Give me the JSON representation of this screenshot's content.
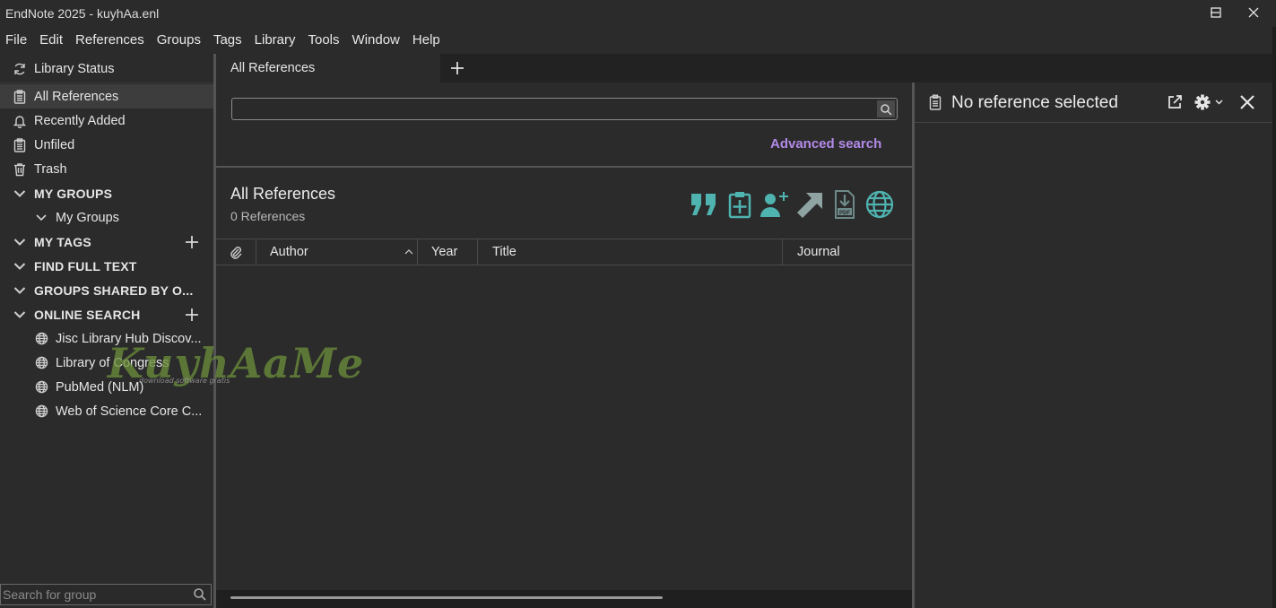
{
  "window": {
    "title": "EndNote 2025 - kuyhAa.enl"
  },
  "menu": [
    "File",
    "Edit",
    "References",
    "Groups",
    "Tags",
    "Library",
    "Tools",
    "Window",
    "Help"
  ],
  "sidebar": {
    "library_status": "Library Status",
    "items": [
      {
        "label": "All References",
        "icon": "clipboard-icon",
        "active": true
      },
      {
        "label": "Recently Added",
        "icon": "bell-icon"
      },
      {
        "label": "Unfiled",
        "icon": "clipboard-icon"
      },
      {
        "label": "Trash",
        "icon": "trash-icon"
      }
    ],
    "my_groups_header": "MY GROUPS",
    "my_groups_sub": "My Groups",
    "my_tags_header": "MY TAGS",
    "find_full_text_header": "FIND FULL TEXT",
    "groups_shared_header": "GROUPS SHARED BY O...",
    "online_search_header": "ONLINE SEARCH",
    "online_items": [
      "Jisc Library Hub Discov...",
      "Library of Congress",
      "PubMed (NLM)",
      "Web of Science Core C..."
    ],
    "group_search_placeholder": "Search for group"
  },
  "tabs": {
    "active_label": "All References"
  },
  "search": {
    "value": "",
    "advanced_label": "Advanced search"
  },
  "references": {
    "title": "All References",
    "count_text": "0 References",
    "columns": [
      "Author",
      "Year",
      "Title",
      "Journal"
    ]
  },
  "toolbar": {
    "icons": [
      "quote-icon",
      "new-reference-icon",
      "share-user-icon",
      "export-arrow-icon",
      "pdf-download-icon",
      "online-globe-icon"
    ],
    "accent_color": "#4fb3b0"
  },
  "detail": {
    "empty_label": "No reference selected"
  },
  "watermark": {
    "text": "KuyhAaMe",
    "sub": "download software gratis"
  }
}
